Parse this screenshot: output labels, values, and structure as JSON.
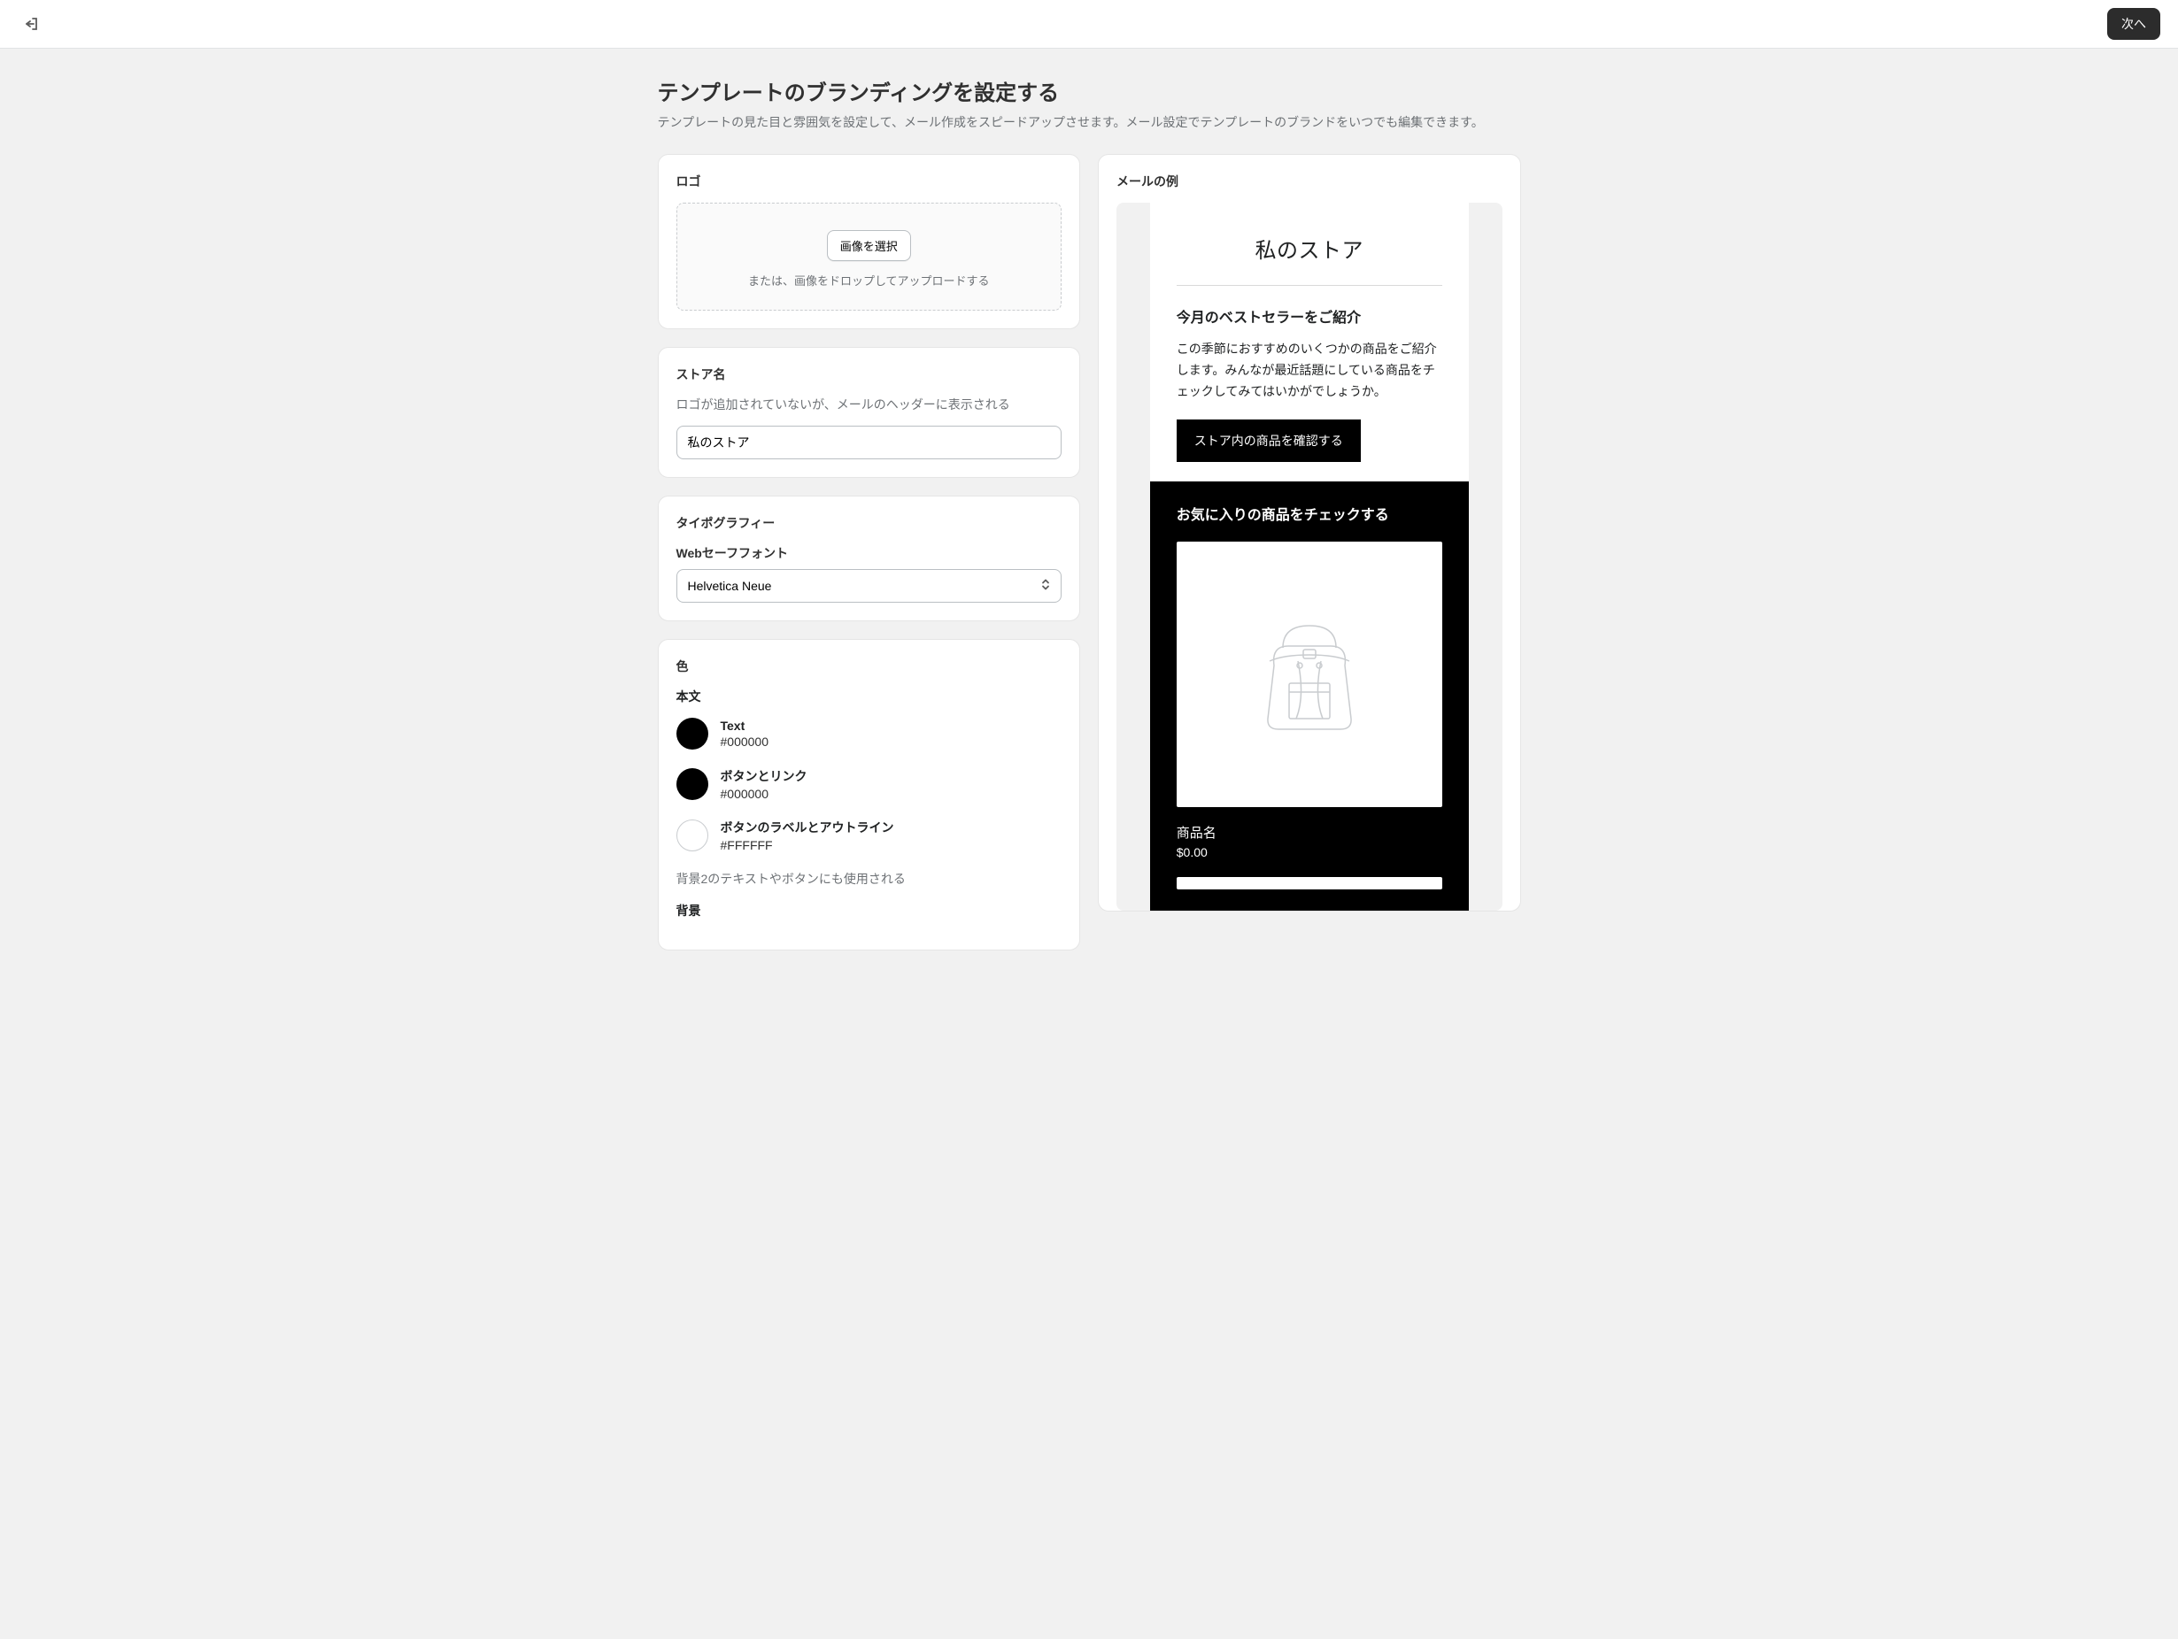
{
  "header": {
    "next_label": "次へ"
  },
  "page": {
    "title": "テンプレートのブランディングを設定する",
    "subtitle": "テンプレートの見た目と雰囲気を設定して、メール作成をスピードアップさせます。メール設定でテンプレートのブランドをいつでも編集できます。"
  },
  "logo": {
    "title": "ロゴ",
    "select_button": "画像を選択",
    "drop_text": "または、画像をドロップしてアップロードする"
  },
  "store_name": {
    "title": "ストア名",
    "subtitle": "ロゴが追加されていないが、メールのヘッダーに表示される",
    "value": "私のストア"
  },
  "typography": {
    "title": "タイポグラフィー",
    "label": "Webセーフフォント",
    "value": "Helvetica Neue"
  },
  "colors": {
    "title": "色",
    "body_label": "本文",
    "items": [
      {
        "name": "Text",
        "hex": "#000000",
        "swatch": "#000000"
      },
      {
        "name": "ボタンとリンク",
        "hex": "#000000",
        "swatch": "#000000"
      },
      {
        "name": "ボタンのラベルとアウトライン",
        "hex": "#FFFFFF",
        "swatch": "#FFFFFF"
      }
    ],
    "note": "背景2のテキストやボタンにも使用される",
    "bg_label": "背景"
  },
  "preview": {
    "title": "メールの例",
    "store_name": "私のストア",
    "heading": "今月のベストセラーをご紹介",
    "paragraph": "この季節におすすめのいくつかの商品をご紹介します。みんなが最近話題にしている商品をチェックしてみてはいかがでしょうか。",
    "cta": "ストア内の商品を確認する",
    "fav_heading": "お気に入りの商品をチェックする",
    "product_name": "商品名",
    "product_price": "$0.00"
  }
}
